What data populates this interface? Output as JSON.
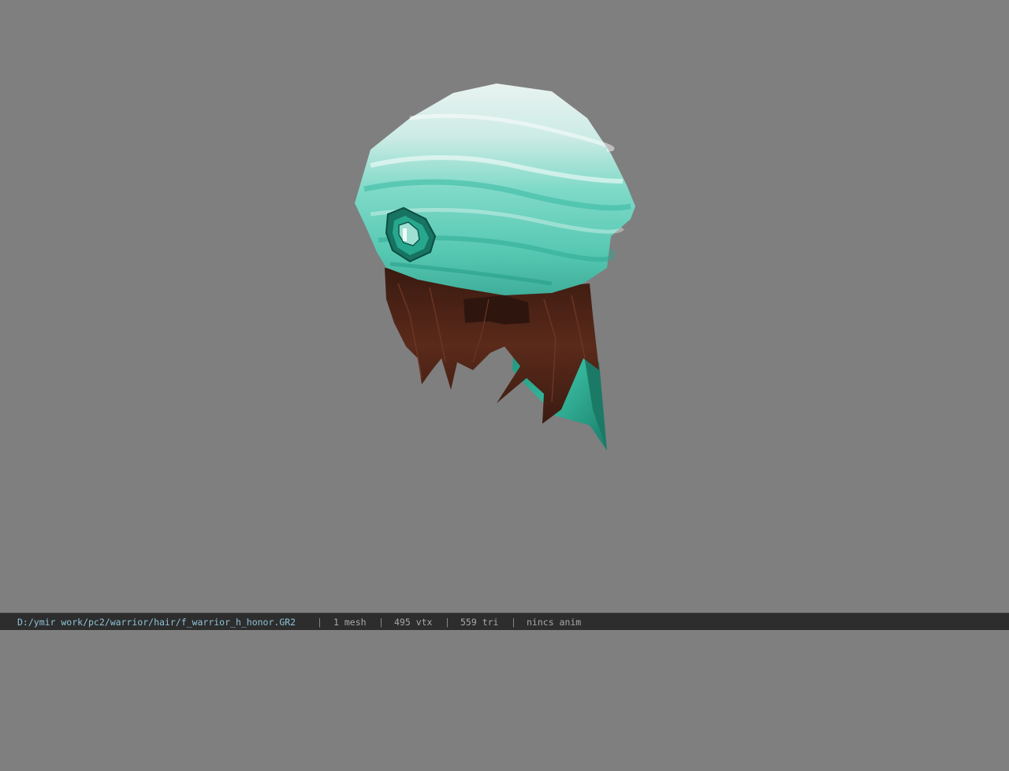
{
  "viewport": {
    "background_color": "#7f7f7f",
    "model": {
      "kind": "hair-helmet-mesh",
      "cap_color": "#5fd0be",
      "hair_color": "#4a2216",
      "ribbon_color": "#2aa88e"
    }
  },
  "statusbar": {
    "file_path": "D:/ymir work/pc2/warrior/hair/f_warrior_h_honor.GR2",
    "separator": "|",
    "mesh_count": "1 mesh",
    "vertex_count": "495 vtx",
    "triangle_count": "559 tri",
    "anim_status": "nincs anim",
    "background_color": "#2d2d2d",
    "path_color": "#8fc3d6"
  }
}
